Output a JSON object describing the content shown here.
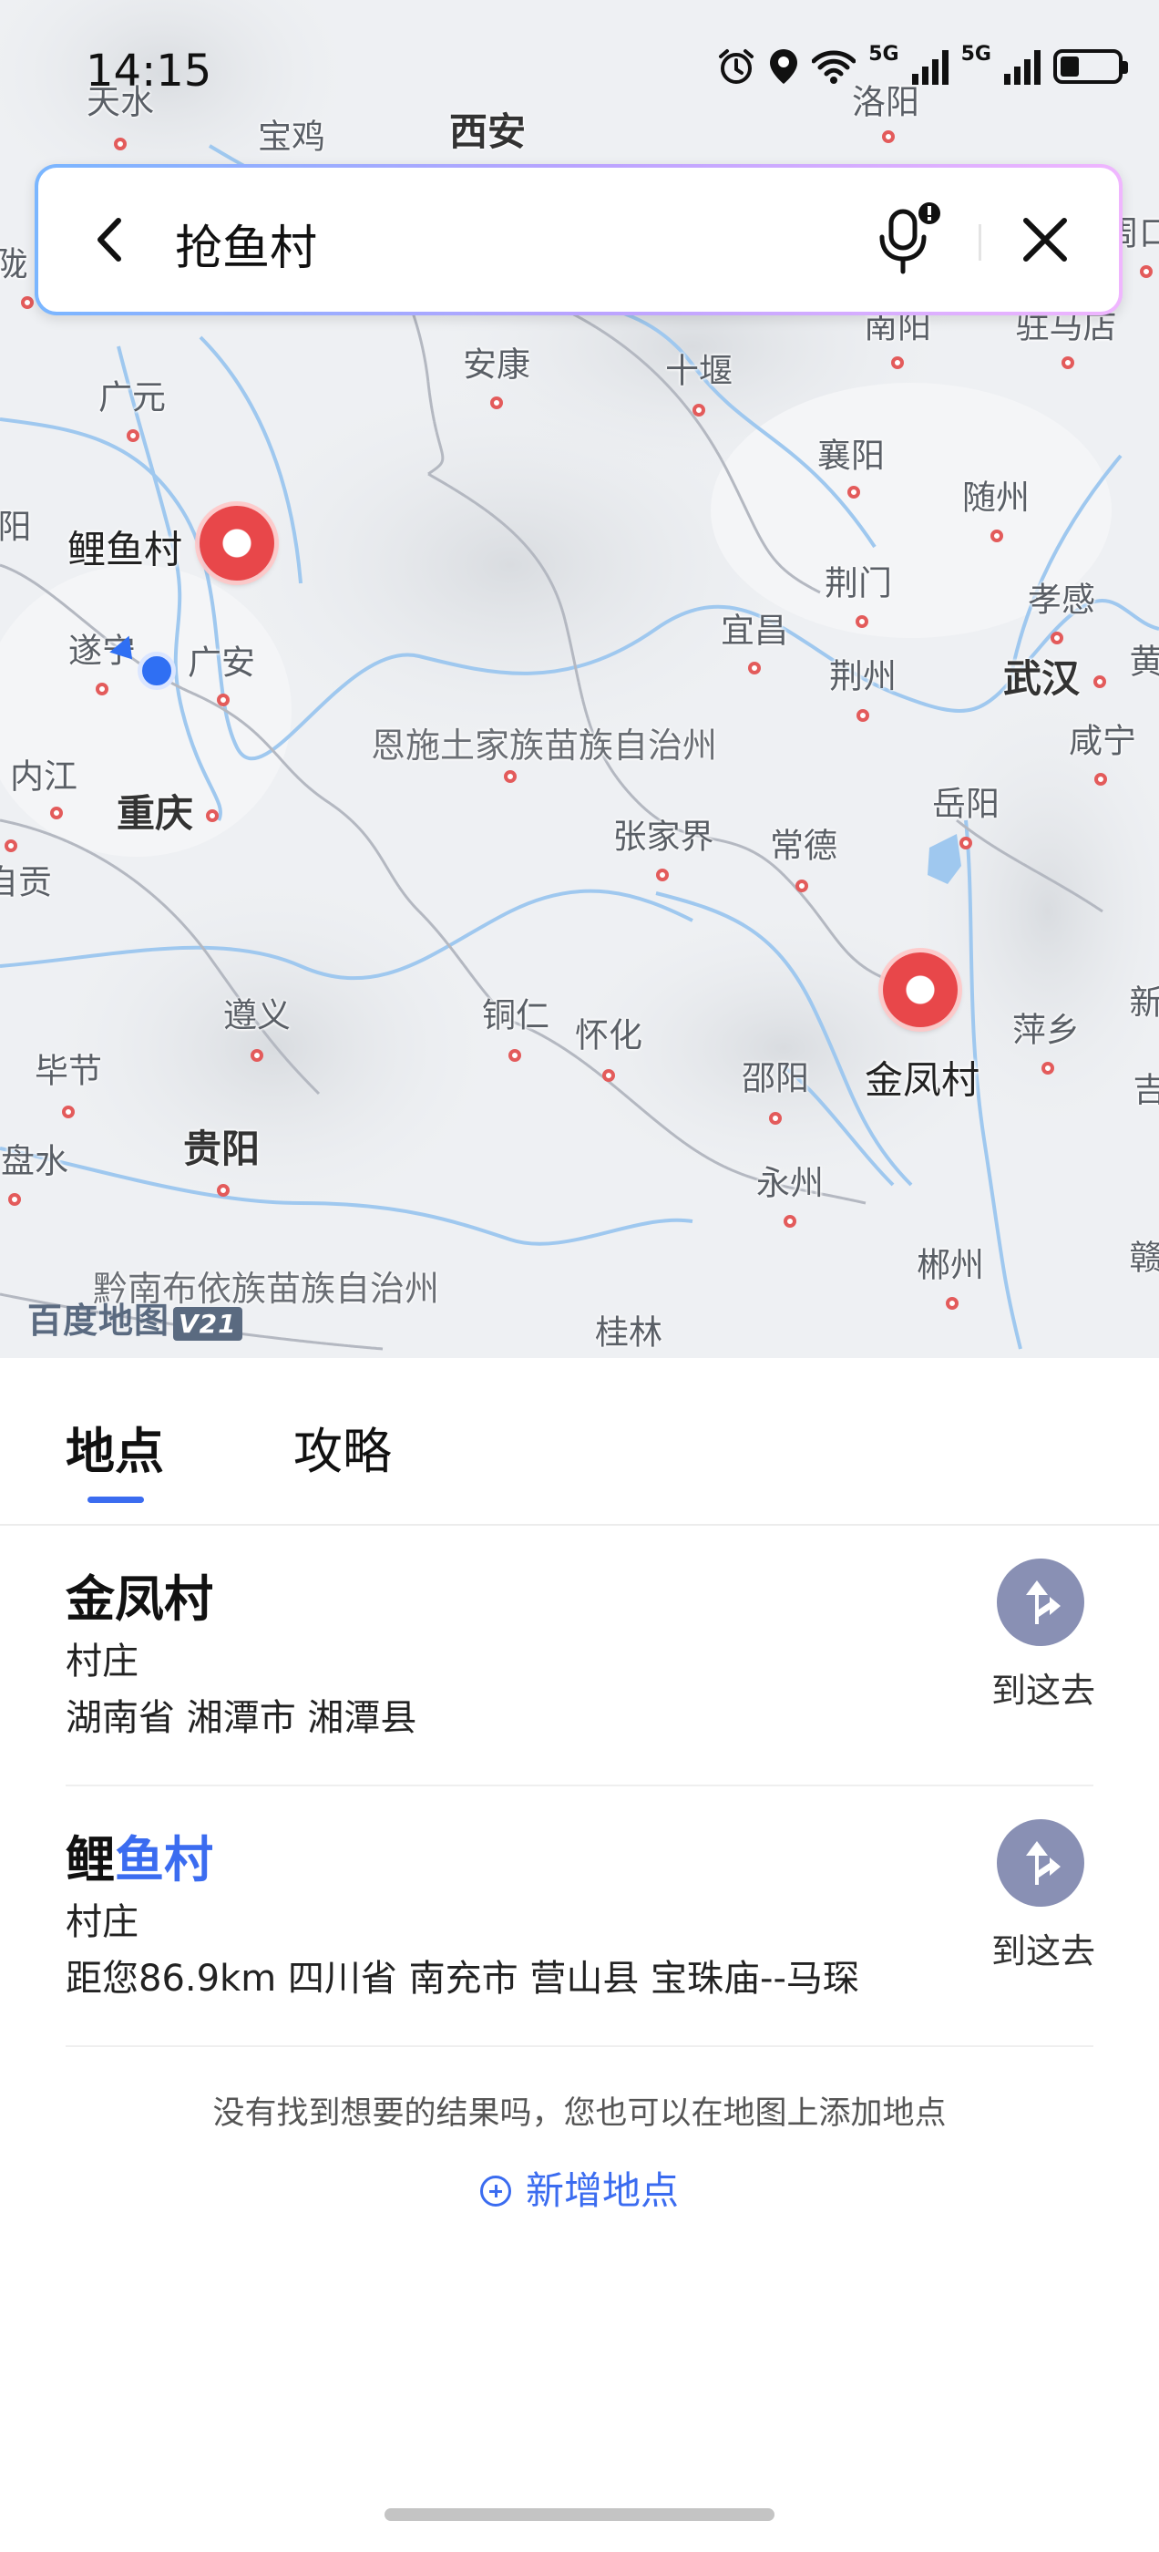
{
  "status_bar": {
    "time": "14:15",
    "network1": "5G",
    "network2": "5G",
    "icons": [
      "alarm-icon",
      "location-icon",
      "wifi-icon",
      "signal-icon",
      "signal-icon",
      "battery-icon"
    ],
    "battery_level": 0.34
  },
  "search": {
    "query": "抢鱼村",
    "icons": [
      "back-arrow-icon",
      "microphone-icon",
      "close-icon"
    ]
  },
  "map": {
    "cities": [
      "天水",
      "宝鸡",
      "西安",
      "洛阳",
      "安康",
      "十堰",
      "南阳",
      "驻马店",
      "广元",
      "襄阳",
      "随州",
      "孝感",
      "荆门",
      "宜昌",
      "荆州",
      "武汉",
      "遂宁",
      "广安",
      "内江",
      "重庆",
      "恩施土家族苗族自治州",
      "张家界",
      "常德",
      "岳阳",
      "咸宁",
      "遵义",
      "铜仁",
      "怀化",
      "邵阳",
      "萍乡",
      "毕节",
      "贵阳",
      "永州",
      "郴州",
      "黔南布依族苗族自治州",
      "桂林",
      "盘水",
      "自贡",
      "阳",
      "黄",
      "新",
      "吉",
      "赣",
      "陇",
      "周口"
    ],
    "pins": [
      "鲤鱼村",
      "金凤村"
    ],
    "watermark": "百度地图",
    "watermark_version": "V21"
  },
  "tabs": {
    "active": "地点",
    "inactive": "攻略"
  },
  "results": [
    {
      "name_plain": "金凤村",
      "name_highlight": "",
      "type": "村庄",
      "address": "湖南省 湘潭市 湘潭县",
      "action": "到这去"
    },
    {
      "name_plain": "鲤",
      "name_highlight": "鱼村",
      "type": "村庄",
      "address": "距您86.9km 四川省 南充市 营山县 宝珠庙--马琛",
      "action": "到这去"
    }
  ],
  "footer": {
    "not_found": "没有找到想要的结果吗，您也可以在地图上添加地点",
    "add_place": "新增地点"
  },
  "colors": {
    "accent": "#3b6cf0",
    "pin_red": "#e8474a",
    "route_button": "#8990b4"
  }
}
